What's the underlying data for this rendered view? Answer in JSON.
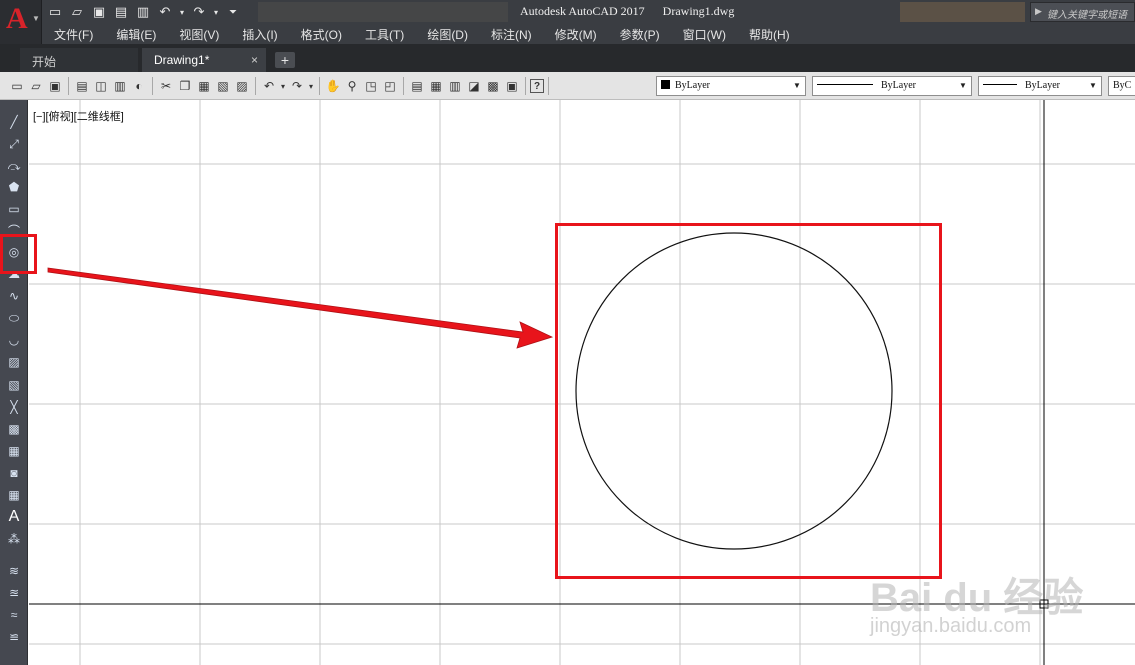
{
  "window": {
    "app_logo": "A",
    "title": "Autodesk AutoCAD 2017",
    "document": "Drawing1.dwg",
    "search_placeholder": "键入关键字或短语"
  },
  "quick_access": [
    "new-icon",
    "open-icon",
    "save-icon",
    "saveas-icon",
    "plot-icon",
    "undo-icon",
    "redo-icon",
    "customize-icon"
  ],
  "menu": [
    "文件(F)",
    "编辑(E)",
    "视图(V)",
    "插入(I)",
    "格式(O)",
    "工具(T)",
    "绘图(D)",
    "标注(N)",
    "修改(M)",
    "参数(P)",
    "窗口(W)",
    "帮助(H)"
  ],
  "tabs": {
    "start": "开始",
    "drawing": "Drawing1*",
    "add": "+"
  },
  "properties": {
    "color": "ByLayer",
    "linetype": "ByLayer",
    "lineweight": "ByLayer",
    "plotstyle": "ByC"
  },
  "viewport_label": "[−][俯视][二维线框]",
  "left_tools": [
    "line-icon",
    "construction-line-icon",
    "polyline-icon",
    "polygon-icon",
    "rectangle-icon",
    "arc-icon",
    "circle-icon",
    "revision-cloud-icon",
    "spline-icon",
    "ellipse-icon",
    "ellipse-arc-icon",
    "insert-block-icon",
    "make-block-icon",
    "point-icon",
    "hatch-icon",
    "gradient-icon",
    "region-icon",
    "table-icon",
    "mtext-icon",
    "add-selected-icon",
    "layer-icon-1",
    "layer-icon-2",
    "layer-icon-3",
    "layer-icon-4"
  ],
  "watermark": {
    "main": "Bai du 经验",
    "sub": "jingyan.baidu.com"
  },
  "colors": {
    "chrome_dark": "#3a3d42",
    "highlight_red": "#e8141b",
    "autocad_red": "#d8232a",
    "grid": "#c8c8c8"
  }
}
